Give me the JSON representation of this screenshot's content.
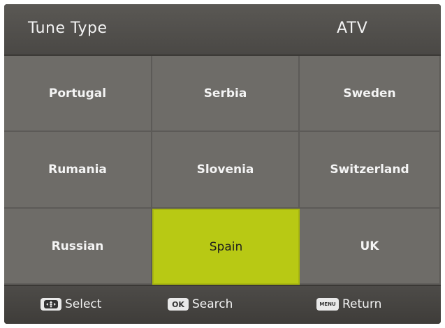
{
  "header": {
    "title": "Tune Type",
    "value": "ATV"
  },
  "countries": [
    [
      "Portugal",
      "Serbia",
      "Sweden"
    ],
    [
      "Rumania",
      "Slovenia",
      "Switzerland"
    ],
    [
      "Russian",
      "Spain",
      "UK"
    ]
  ],
  "selected_country": "Spain",
  "footer": {
    "select_key": "nav-dpad-icon",
    "select_label": "Select",
    "search_key": "OK",
    "search_label": "Search",
    "return_key": "MENU",
    "return_label": "Return"
  },
  "colors": {
    "background": "#6c6a66",
    "header": "#4f4d4a",
    "highlight": "#b8c914",
    "text": "#f4f4f4"
  }
}
